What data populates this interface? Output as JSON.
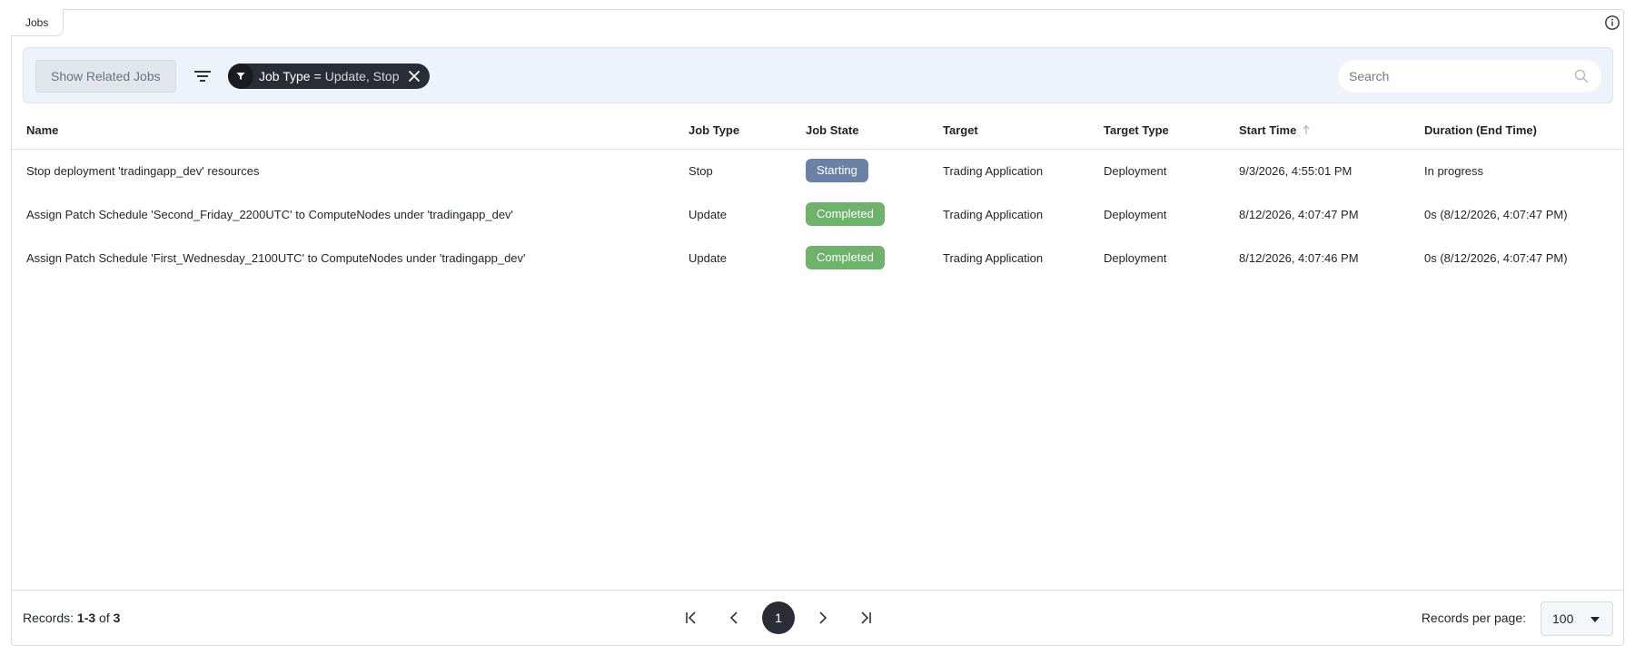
{
  "window": {
    "tab_label": "Jobs",
    "info_icon": "info-icon"
  },
  "toolbar": {
    "related_label": "Show Related Jobs",
    "filter_icon": "filter-lines-icon",
    "chip": {
      "key": "Job Type",
      "operator": "=",
      "value": "Update, Stop",
      "icon": "funnel-icon",
      "close_icon": "close-icon"
    },
    "search_placeholder": "Search",
    "search_value": ""
  },
  "table": {
    "columns": [
      "Name",
      "Job Type",
      "Job State",
      "Target",
      "Target Type",
      "Start Time",
      "Duration (End Time)"
    ],
    "sort_column": "Start Time",
    "sort_icon": "arrow-up-icon",
    "rows": [
      {
        "name": "Stop deployment 'tradingapp_dev' resources",
        "job_type": "Stop",
        "job_state": "Starting",
        "target": "Trading Application",
        "target_type": "Deployment",
        "start_time": "9/3/2026, 4:55:01 PM",
        "duration": "In progress"
      },
      {
        "name": "Assign Patch Schedule 'Second_Friday_2200UTC' to ComputeNodes under 'tradingapp_dev'",
        "job_type": "Update",
        "job_state": "Completed",
        "target": "Trading Application",
        "target_type": "Deployment",
        "start_time": "8/12/2026, 4:07:47 PM",
        "duration": "0s (8/12/2026, 4:07:47 PM)"
      },
      {
        "name": "Assign Patch Schedule 'First_Wednesday_2100UTC' to ComputeNodes under 'tradingapp_dev'",
        "job_type": "Update",
        "job_state": "Completed",
        "target": "Trading Application",
        "target_type": "Deployment",
        "start_time": "8/12/2026, 4:07:46 PM",
        "duration": "0s (8/12/2026, 4:07:47 PM)"
      }
    ]
  },
  "footer": {
    "records_prefix": "Records:",
    "records_range": "1-3",
    "records_of": "of",
    "records_total": "3",
    "current_page": "1",
    "rpp_label": "Records per page:",
    "rpp_value": "100"
  },
  "colors": {
    "starting": "#6b82a6",
    "completed": "#6db36a",
    "dark": "#2a2d36",
    "toolbar_bg": "#eef3fb"
  }
}
